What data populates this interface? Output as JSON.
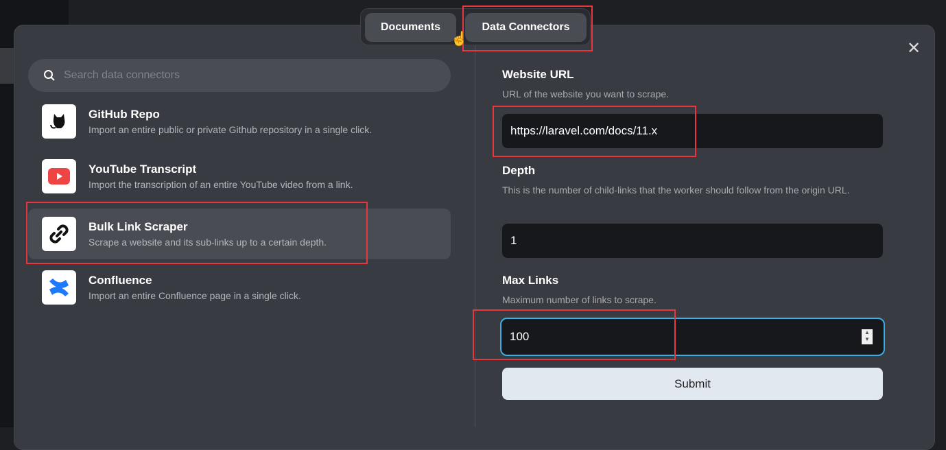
{
  "tabs": [
    {
      "label": "Documents"
    },
    {
      "label": "Data Connectors",
      "active": true
    }
  ],
  "search": {
    "placeholder": "Search data connectors",
    "icon": "search-icon"
  },
  "connectors": [
    {
      "title": "GitHub Repo",
      "description": "Import an entire public or private Github repository in a single click.",
      "icon": "github-icon"
    },
    {
      "title": "YouTube Transcript",
      "description": "Import the transcription of an entire YouTube video from a link.",
      "icon": "youtube-icon"
    },
    {
      "title": "Bulk Link Scraper",
      "description": "Scrape a website and its sub-links up to a certain depth.",
      "icon": "link-icon",
      "selected": true
    },
    {
      "title": "Confluence",
      "description": "Import an entire Confluence page in a single click.",
      "icon": "confluence-icon"
    }
  ],
  "form": {
    "url": {
      "label": "Website URL",
      "help": "URL of the website you want to scrape.",
      "value": "https://laravel.com/docs/11.x"
    },
    "depth": {
      "label": "Depth",
      "help": "This is the number of child-links that the worker should follow from the origin URL.",
      "value": "1"
    },
    "max_links": {
      "label": "Max Links",
      "help": "Maximum number of links to scrape.",
      "value": "100"
    },
    "submit_label": "Submit"
  },
  "colors": {
    "accent_focus": "#3ab0e6",
    "annotation": "#e8383d",
    "youtube": "#ef4444",
    "confluence": "#1d7afc"
  }
}
